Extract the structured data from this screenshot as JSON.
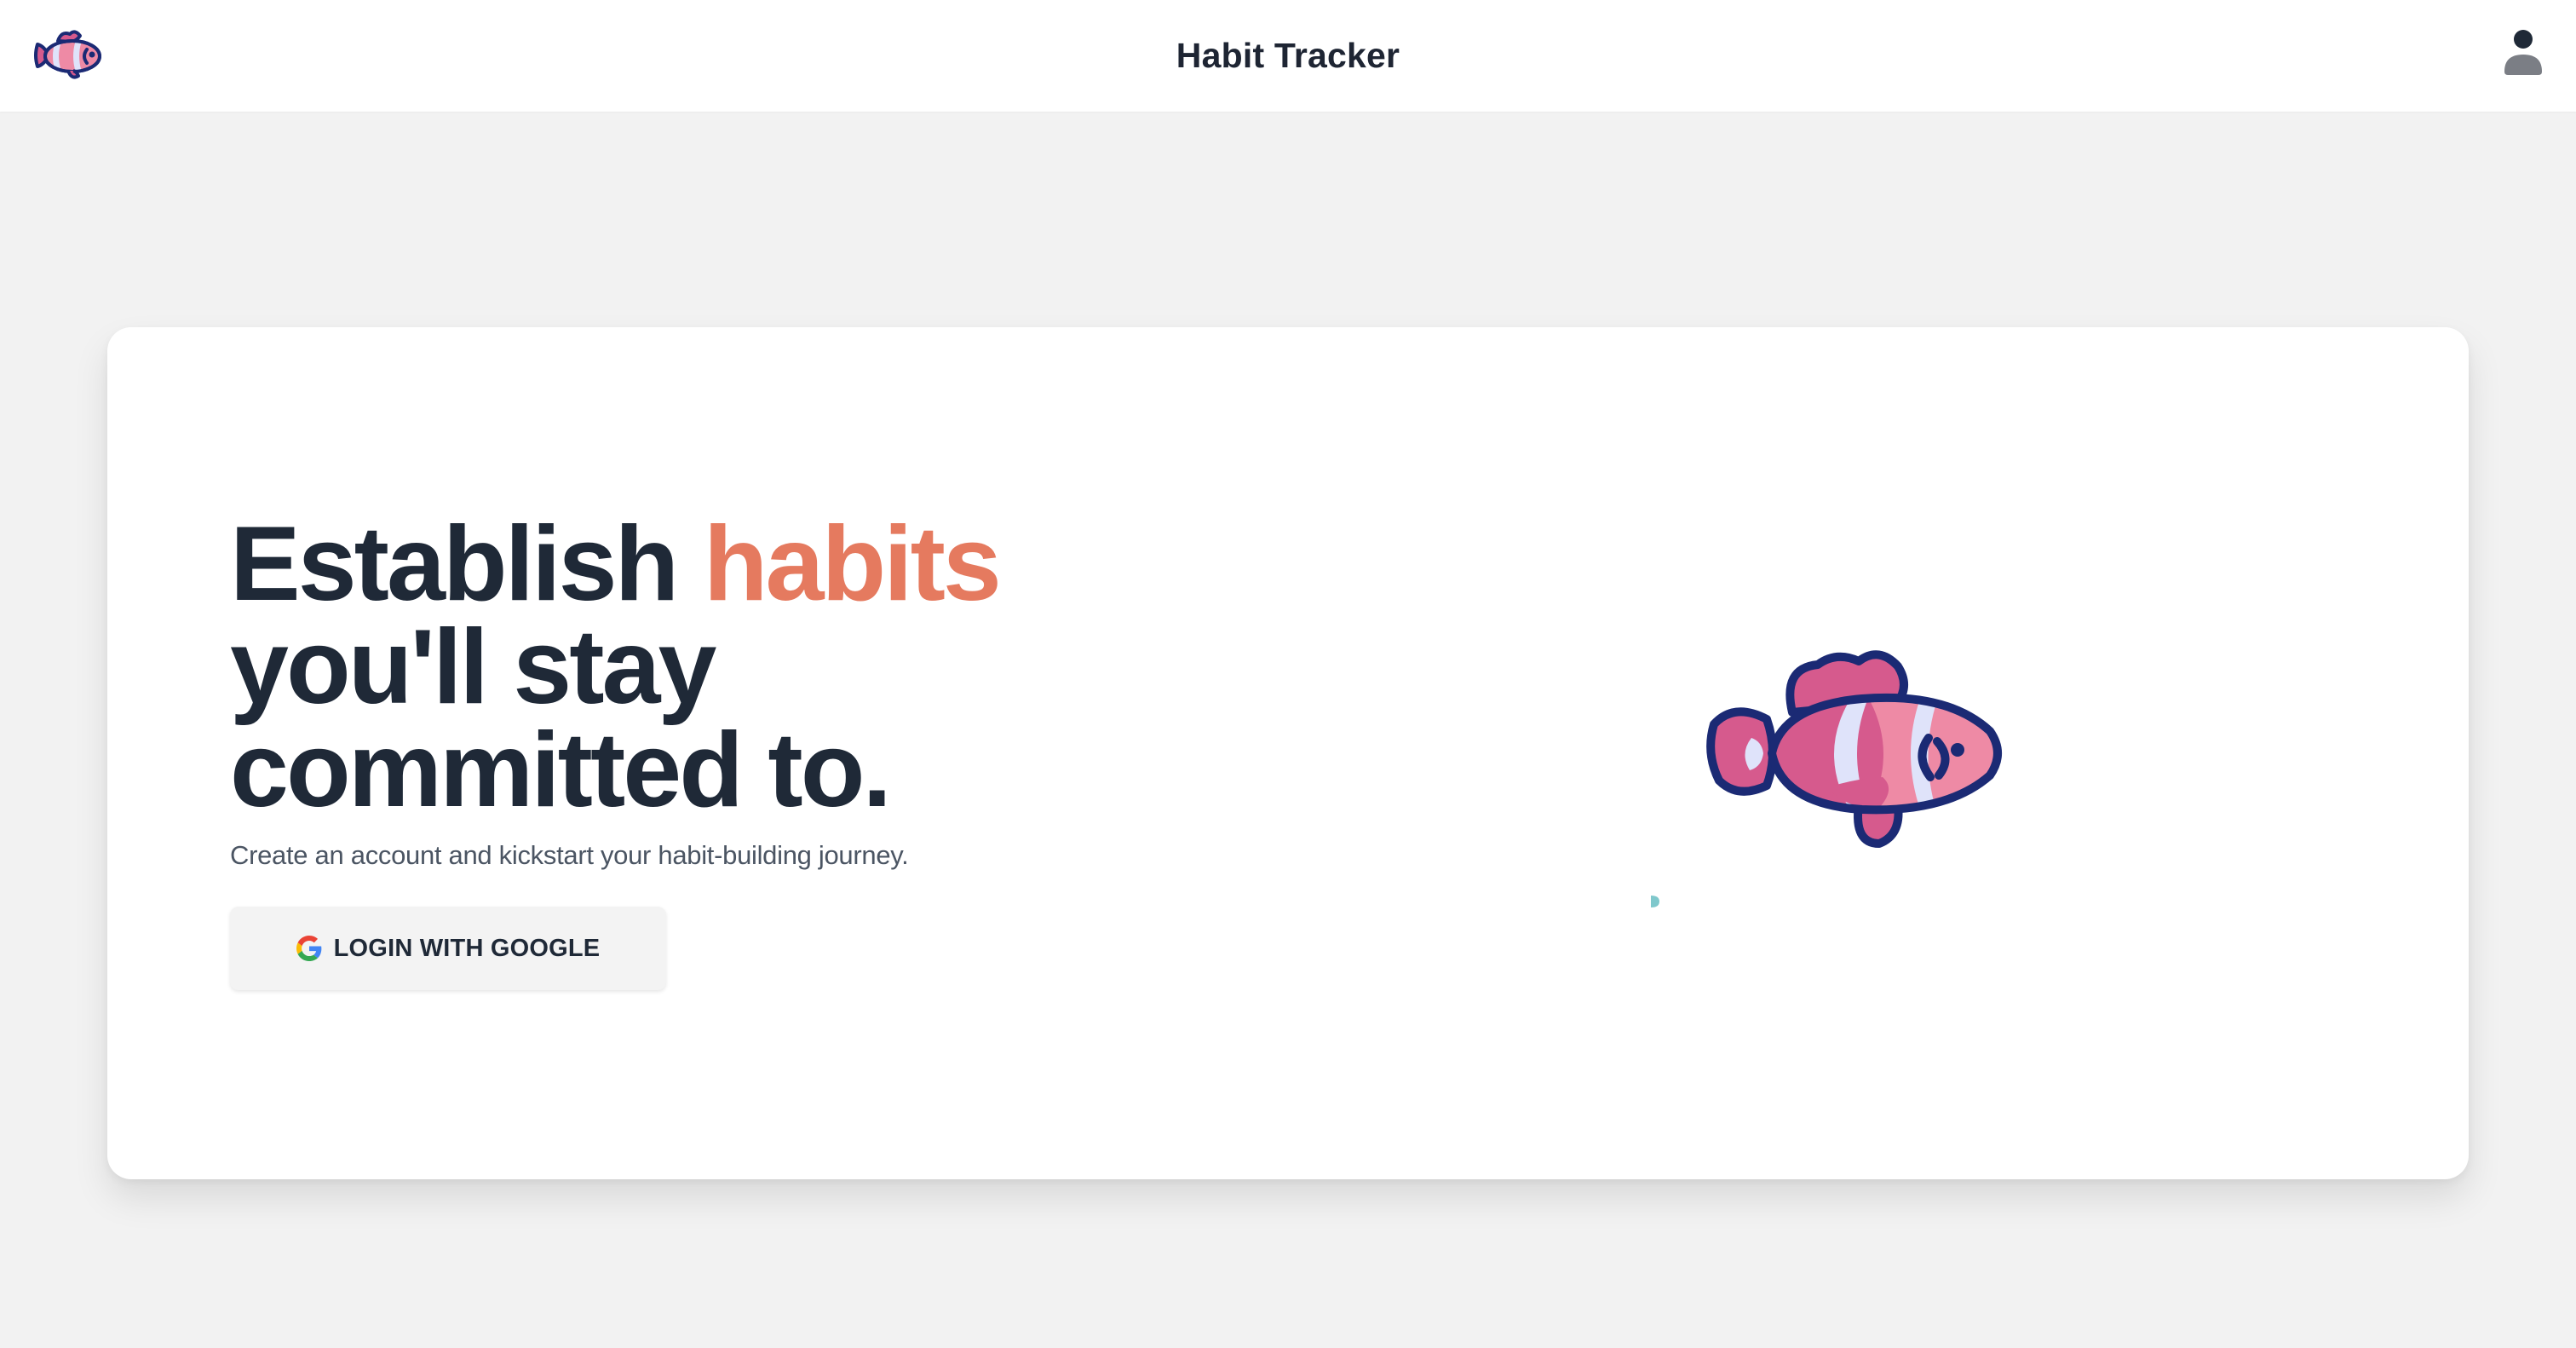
{
  "header": {
    "logo_icon": "clownfish-logo-icon",
    "title": "Habit Tracker",
    "user_icon": "user-account-icon"
  },
  "hero": {
    "heading_part1": "Establish",
    "heading_accent": "habits",
    "heading_part2": "you'll stay",
    "heading_part3": "committed to.",
    "subtitle": "Create an account and kickstart your habit-building journey.",
    "login_button_label": "LOGIN WITH GOOGLE",
    "login_button_icon": "google-g-icon",
    "illustration_icon": "clownfish-illustration",
    "bubble_icon": "bubble-icon"
  },
  "colors": {
    "page_background": "#f2f2f2",
    "heading_text": "#1f2937",
    "accent": "#e57a5f",
    "fish_pink": "#d65a8d",
    "fish_light_pink": "#ee8aa5",
    "fish_outline": "#1b2a74",
    "fish_white_stripe": "#dfe3fa",
    "bubble": "#7fc8cc"
  }
}
